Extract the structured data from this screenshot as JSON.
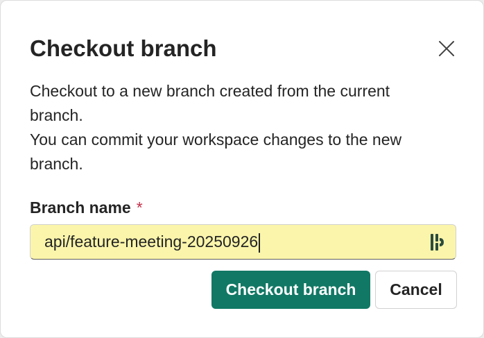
{
  "dialog": {
    "title": "Checkout branch",
    "description_lines": [
      "Checkout to a new branch created from the current branch.",
      "You can commit your workspace changes to the new branch."
    ],
    "close_icon": "close-icon"
  },
  "field": {
    "label": "Branch name",
    "required_mark": "*",
    "value": "api/feature-meeting-20250926",
    "extension_icon": "password-manager-icon"
  },
  "actions": {
    "primary_label": "Checkout branch",
    "secondary_label": "Cancel"
  },
  "colors": {
    "primary": "#117865",
    "input_autofill_bg": "#faf5ab",
    "required": "#c4314b",
    "text": "#242424"
  }
}
